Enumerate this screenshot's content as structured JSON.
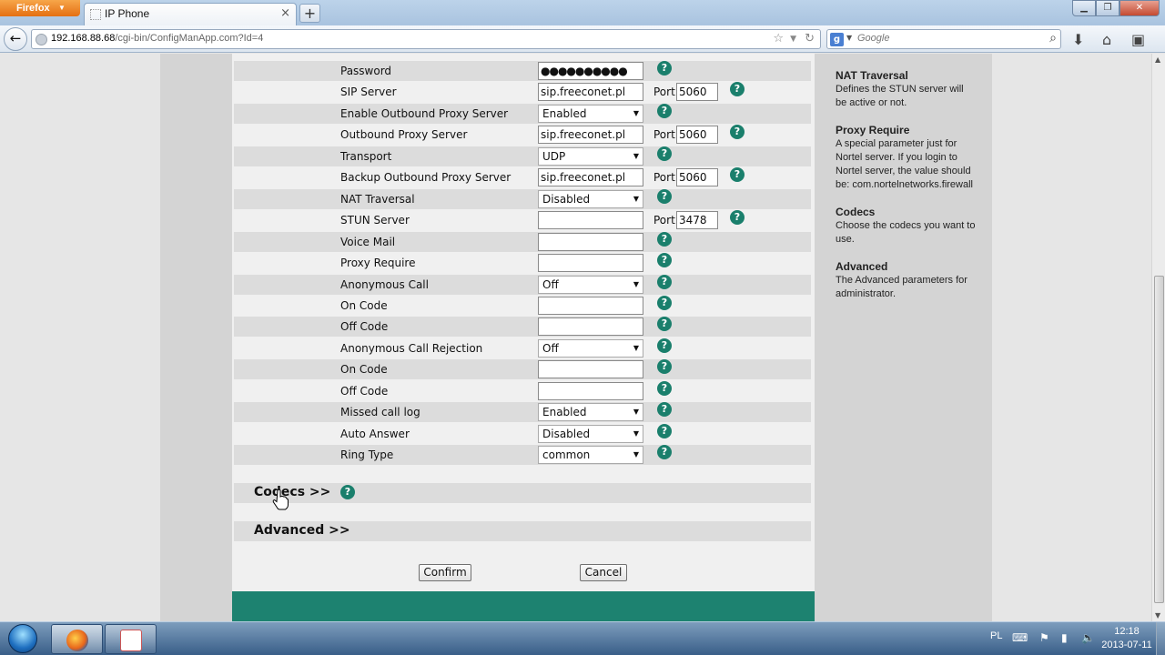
{
  "browser": {
    "menu_label": "Firefox",
    "tab_title": "IP Phone",
    "url_host": "192.168.88.68",
    "url_path": "/cgi-bin/ConfigManApp.com?Id=4",
    "search_placeholder": "Google"
  },
  "form": {
    "rows": [
      {
        "label": "Password",
        "type": "password",
        "value": "●●●●●●●●●●"
      },
      {
        "label": "SIP Server",
        "type": "text",
        "value": "sip.freeconet.pl",
        "port_label": "Port",
        "port": "5060"
      },
      {
        "label": "Enable Outbound Proxy Server",
        "type": "select",
        "value": "Enabled"
      },
      {
        "label": "Outbound Proxy Server",
        "type": "text",
        "value": "sip.freeconet.pl",
        "port_label": "Port",
        "port": "5060"
      },
      {
        "label": "Transport",
        "type": "select",
        "value": "UDP"
      },
      {
        "label": "Backup Outbound Proxy Server",
        "type": "text",
        "value": "sip.freeconet.pl",
        "port_label": "Port",
        "port": "5060"
      },
      {
        "label": "NAT Traversal",
        "type": "select",
        "value": "Disabled"
      },
      {
        "label": "STUN Server",
        "type": "text",
        "value": "",
        "port_label": "Port",
        "port": "3478"
      },
      {
        "label": "Voice Mail",
        "type": "text",
        "value": ""
      },
      {
        "label": "Proxy Require",
        "type": "text",
        "value": ""
      },
      {
        "label": "Anonymous Call",
        "type": "select",
        "value": "Off"
      },
      {
        "label": "On Code",
        "type": "text",
        "value": ""
      },
      {
        "label": "Off Code",
        "type": "text",
        "value": ""
      },
      {
        "label": "Anonymous Call Rejection",
        "type": "select",
        "value": "Off"
      },
      {
        "label": "On Code",
        "type": "text",
        "value": ""
      },
      {
        "label": "Off Code",
        "type": "text",
        "value": ""
      },
      {
        "label": "Missed call log",
        "type": "select",
        "value": "Enabled"
      },
      {
        "label": "Auto Answer",
        "type": "select",
        "value": "Disabled"
      },
      {
        "label": "Ring Type",
        "type": "select",
        "value": "common"
      }
    ],
    "codecs_label": "Codecs >>",
    "advanced_label": "Advanced >>",
    "confirm_label": "Confirm",
    "cancel_label": "Cancel"
  },
  "help": [
    {
      "title": "NAT Traversal",
      "text": "Defines the STUN server will be active or not."
    },
    {
      "title": "Proxy Require",
      "text": "A special parameter just for Nortel server. If you login to Nortel server, the value should be: com.nortelnetworks.firewall"
    },
    {
      "title": "Codecs",
      "text": "Choose the codecs you want to use."
    },
    {
      "title": "Advanced",
      "text": "The Advanced parameters for administrator."
    }
  ],
  "taskbar": {
    "lang": "PL",
    "time": "12:18",
    "date": "2013-07-11"
  },
  "colors": {
    "accent_teal": "#1a7f6c",
    "footer_teal": "#1d8270"
  }
}
